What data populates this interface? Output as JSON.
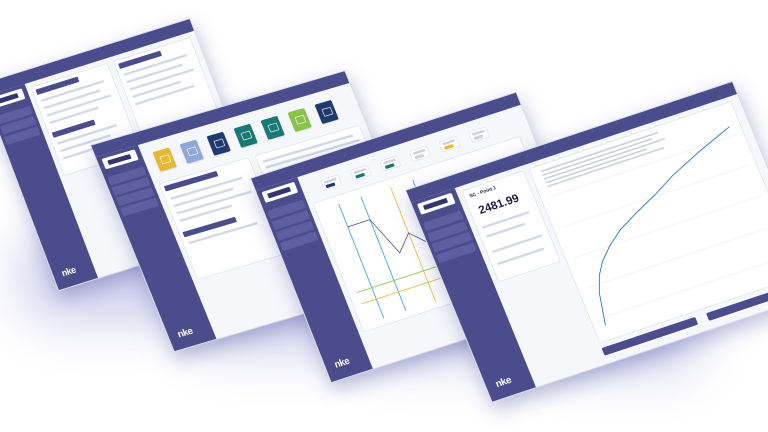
{
  "colors": {
    "brand": "#4a4c8c",
    "accent": "#1f6fb3",
    "tile_yellow": "#e5b933",
    "tile_lightblue": "#8fa8d9",
    "tile_navy": "#1f3b6d",
    "tile_teal": "#1a7a73",
    "tile_green": "#88c24a"
  },
  "brand": {
    "name": "nke",
    "subtitle": "DEMO"
  },
  "screen4": {
    "panel_title": "SC - Point 1",
    "value": "2481.99"
  },
  "icons": [
    "logo-icon",
    "tile-icon",
    "chart-icon"
  ]
}
